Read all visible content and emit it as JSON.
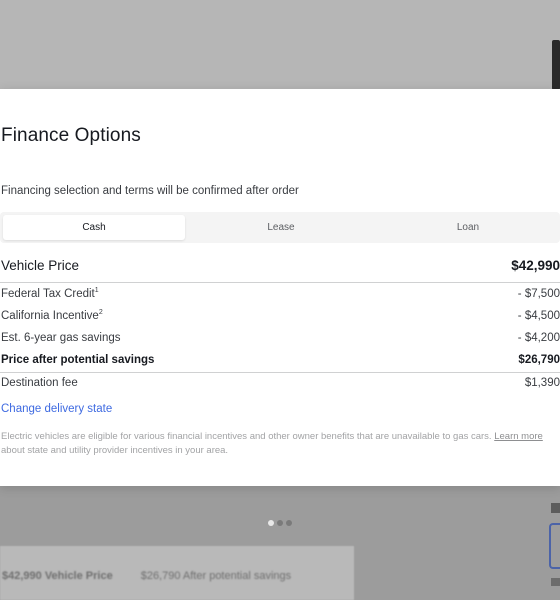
{
  "modal": {
    "title": "Finance Options",
    "subtitle": "Financing selection and terms will be confirmed after order",
    "tabs": [
      {
        "label": "Cash",
        "active": true
      },
      {
        "label": "Lease",
        "active": false
      },
      {
        "label": "Loan",
        "active": false
      }
    ],
    "vehicle_price": {
      "label": "Vehicle Price",
      "value": "$42,990"
    },
    "rows": [
      {
        "label": "Federal Tax Credit",
        "sup": "1",
        "value": "- $7,500"
      },
      {
        "label": "California Incentive",
        "sup": "2",
        "value": "- $4,500"
      },
      {
        "label": "Est. 6-year gas savings",
        "value": "- $4,200"
      },
      {
        "label": "Price after potential savings",
        "value": "$26,790"
      },
      {
        "label": "Destination fee",
        "value": "$1,390"
      }
    ],
    "change_link": "Change delivery state",
    "disclaimer": {
      "before": "Electric vehicles are eligible for various financial incentives and other owner benefits that are unavailable to gas cars. ",
      "link": "Learn more",
      "after": " about state and utility provider incentives in your area."
    }
  },
  "background": {
    "card_price": "$42,990 Vehicle Price",
    "card_savings": "$26,790 After potential savings"
  },
  "colors": {
    "accent_link": "#3e6ae1",
    "text_primary": "#171a20",
    "text_secondary": "#393c41",
    "tab_track": "#f4f4f4"
  }
}
